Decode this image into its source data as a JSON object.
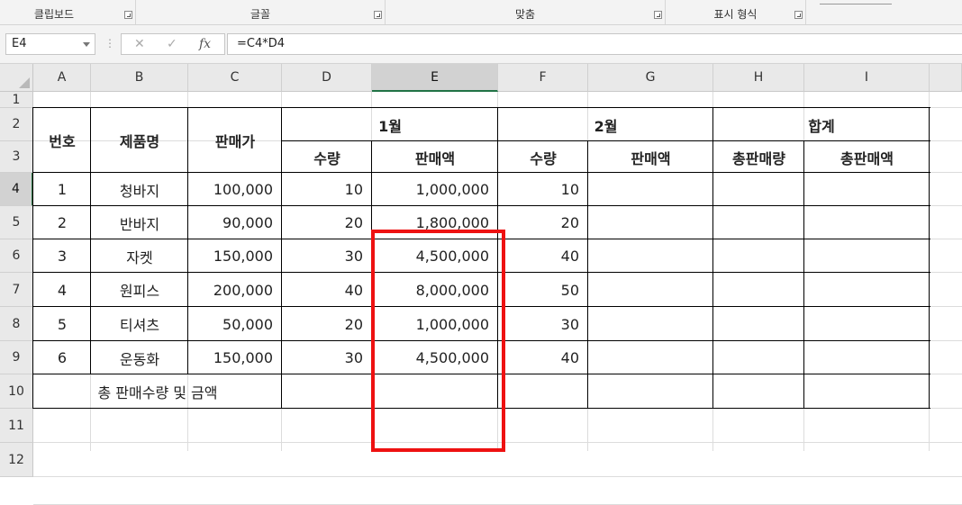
{
  "ribbon": {
    "groups": [
      {
        "label": "클립보드"
      },
      {
        "label": "글꼴"
      },
      {
        "label": "맞춤"
      },
      {
        "label": "표시 형식"
      }
    ]
  },
  "formula_bar": {
    "name_box": "E4",
    "cancel_icon": "✕",
    "enter_icon": "✓",
    "fx_label": "fx",
    "formula": "=C4*D4"
  },
  "columns": [
    "A",
    "B",
    "C",
    "D",
    "E",
    "F",
    "G",
    "H",
    "I"
  ],
  "selected_column": "E",
  "rows": [
    "1",
    "2",
    "3",
    "4",
    "5",
    "6",
    "7",
    "8",
    "9",
    "10",
    "11",
    "12"
  ],
  "selected_row": "4",
  "table": {
    "headers": {
      "no": "번호",
      "product": "제품명",
      "price": "판매가",
      "jan": "1월",
      "feb": "2월",
      "total": "합계",
      "jan_qty": "수량",
      "jan_amount": "판매액",
      "feb_qty": "수량",
      "feb_amount": "판매액",
      "total_qty": "총판매량",
      "total_amount": "총판매액"
    },
    "rows": [
      {
        "no": "1",
        "product": "청바지",
        "price": "100,000",
        "jan_qty": "10",
        "jan_amount": "1,000,000",
        "feb_qty": "10"
      },
      {
        "no": "2",
        "product": "반바지",
        "price": "90,000",
        "jan_qty": "20",
        "jan_amount": "1,800,000",
        "feb_qty": "20"
      },
      {
        "no": "3",
        "product": "자켓",
        "price": "150,000",
        "jan_qty": "30",
        "jan_amount": "4,500,000",
        "feb_qty": "40"
      },
      {
        "no": "4",
        "product": "원피스",
        "price": "200,000",
        "jan_qty": "40",
        "jan_amount": "8,000,000",
        "feb_qty": "50"
      },
      {
        "no": "5",
        "product": "티셔츠",
        "price": "50,000",
        "jan_qty": "20",
        "jan_amount": "1,000,000",
        "feb_qty": "30"
      },
      {
        "no": "6",
        "product": "운동화",
        "price": "150,000",
        "jan_qty": "30",
        "jan_amount": "4,500,000",
        "feb_qty": "40"
      }
    ],
    "summary_label": "총 판매수량 및 금액"
  },
  "colors": {
    "highlight": "#ee1111",
    "selection_accent": "#217346"
  }
}
